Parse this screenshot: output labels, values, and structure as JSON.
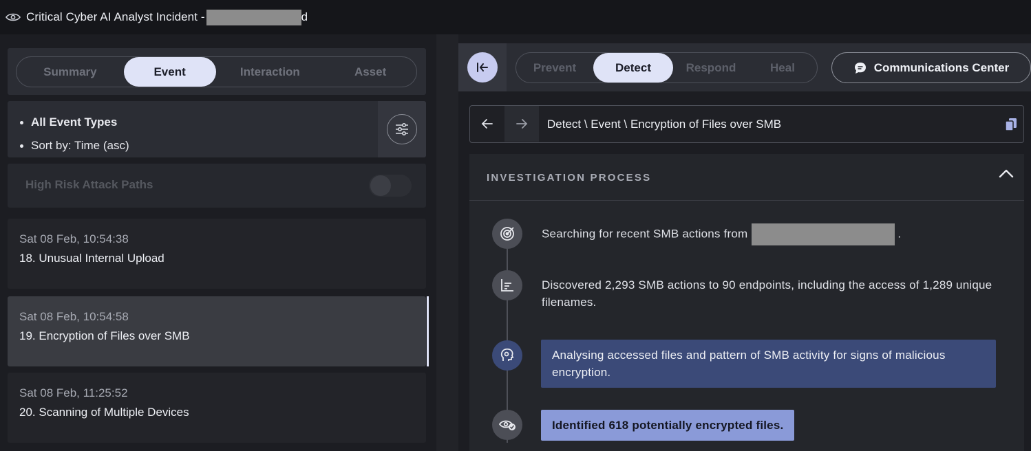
{
  "window": {
    "title": "Critical Cyber AI Analyst Incident -",
    "title_suffix": "d"
  },
  "left_panel": {
    "tabs": [
      {
        "label": "Summary",
        "active": false
      },
      {
        "label": "Event",
        "active": true
      },
      {
        "label": "Interaction",
        "active": false
      },
      {
        "label": "Asset",
        "active": false
      }
    ],
    "filters": {
      "event_types": "All Event Types",
      "sort": "Sort by: Time (asc)"
    },
    "high_risk": {
      "label": "High Risk Attack Paths",
      "enabled": false
    },
    "events": [
      {
        "time": "Sat 08 Feb, 10:54:38",
        "name": "18. Unusual Internal Upload",
        "selected": false
      },
      {
        "time": "Sat 08 Feb, 10:54:58",
        "name": "19. Encryption of Files over SMB",
        "selected": true
      },
      {
        "time": "Sat 08 Feb, 11:25:52",
        "name": "20. Scanning of Multiple Devices",
        "selected": false
      }
    ]
  },
  "right_panel": {
    "stages": [
      {
        "label": "Prevent",
        "active": false
      },
      {
        "label": "Detect",
        "active": true
      },
      {
        "label": "Respond",
        "active": false
      },
      {
        "label": "Heal",
        "active": false
      }
    ],
    "communications_label": "Communications Center",
    "breadcrumb": "Detect \\ Event \\ Encryption of Files over SMB",
    "investigation": {
      "heading": "INVESTIGATION PROCESS",
      "steps": [
        {
          "icon": "target-icon",
          "text": "Searching for recent SMB actions from",
          "text_end": "."
        },
        {
          "icon": "bar-chart-icon",
          "text": "Discovered 2,293 SMB actions to 90 endpoints, including the access of 1,289 unique filenames."
        },
        {
          "icon": "brain-head-icon",
          "text": "Analysing accessed files and pattern of SMB activity for signs of malicious encryption."
        },
        {
          "icon": "eye-check-icon",
          "text": "Identified 618 potentially encrypted files."
        }
      ]
    }
  },
  "colors": {
    "accent": "#dfe3f7",
    "highlight_box": "#3b4a78",
    "final_box": "#8a9ad8"
  }
}
